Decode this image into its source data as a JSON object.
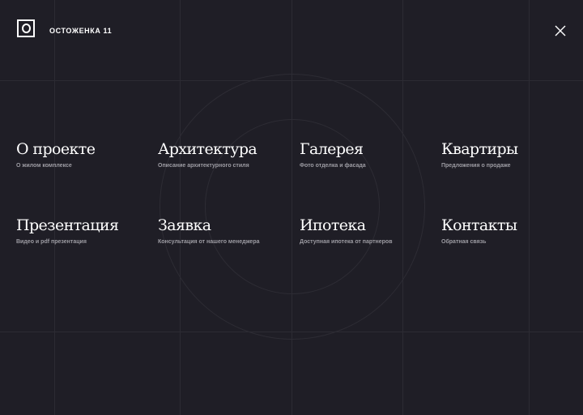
{
  "header": {
    "brand": "ОСТОЖЕНКА 11",
    "logo_icon": "square-circle-logo",
    "close_icon": "close-icon"
  },
  "menu": {
    "items": [
      {
        "title": "О проекте",
        "subtitle": "О жилом комплексе"
      },
      {
        "title": "Архитектура",
        "subtitle": "Описание архитектурного стиля"
      },
      {
        "title": "Галерея",
        "subtitle": "Фото отделка и фасада"
      },
      {
        "title": "Квартиры",
        "subtitle": "Предложения о продаже"
      },
      {
        "title": "Презентация",
        "subtitle": "Видео и pdf презентация"
      },
      {
        "title": "Заявка",
        "subtitle": "Консультация от нашего менеджера"
      },
      {
        "title": "Ипотека",
        "subtitle": "Доступная ипотека от партнеров"
      },
      {
        "title": "Контакты",
        "subtitle": "Обратная связь"
      }
    ]
  },
  "colors": {
    "background": "#1f1e26",
    "text": "#ffffff",
    "subtext": "#9d9ca3",
    "lines": "#2c2b33"
  }
}
